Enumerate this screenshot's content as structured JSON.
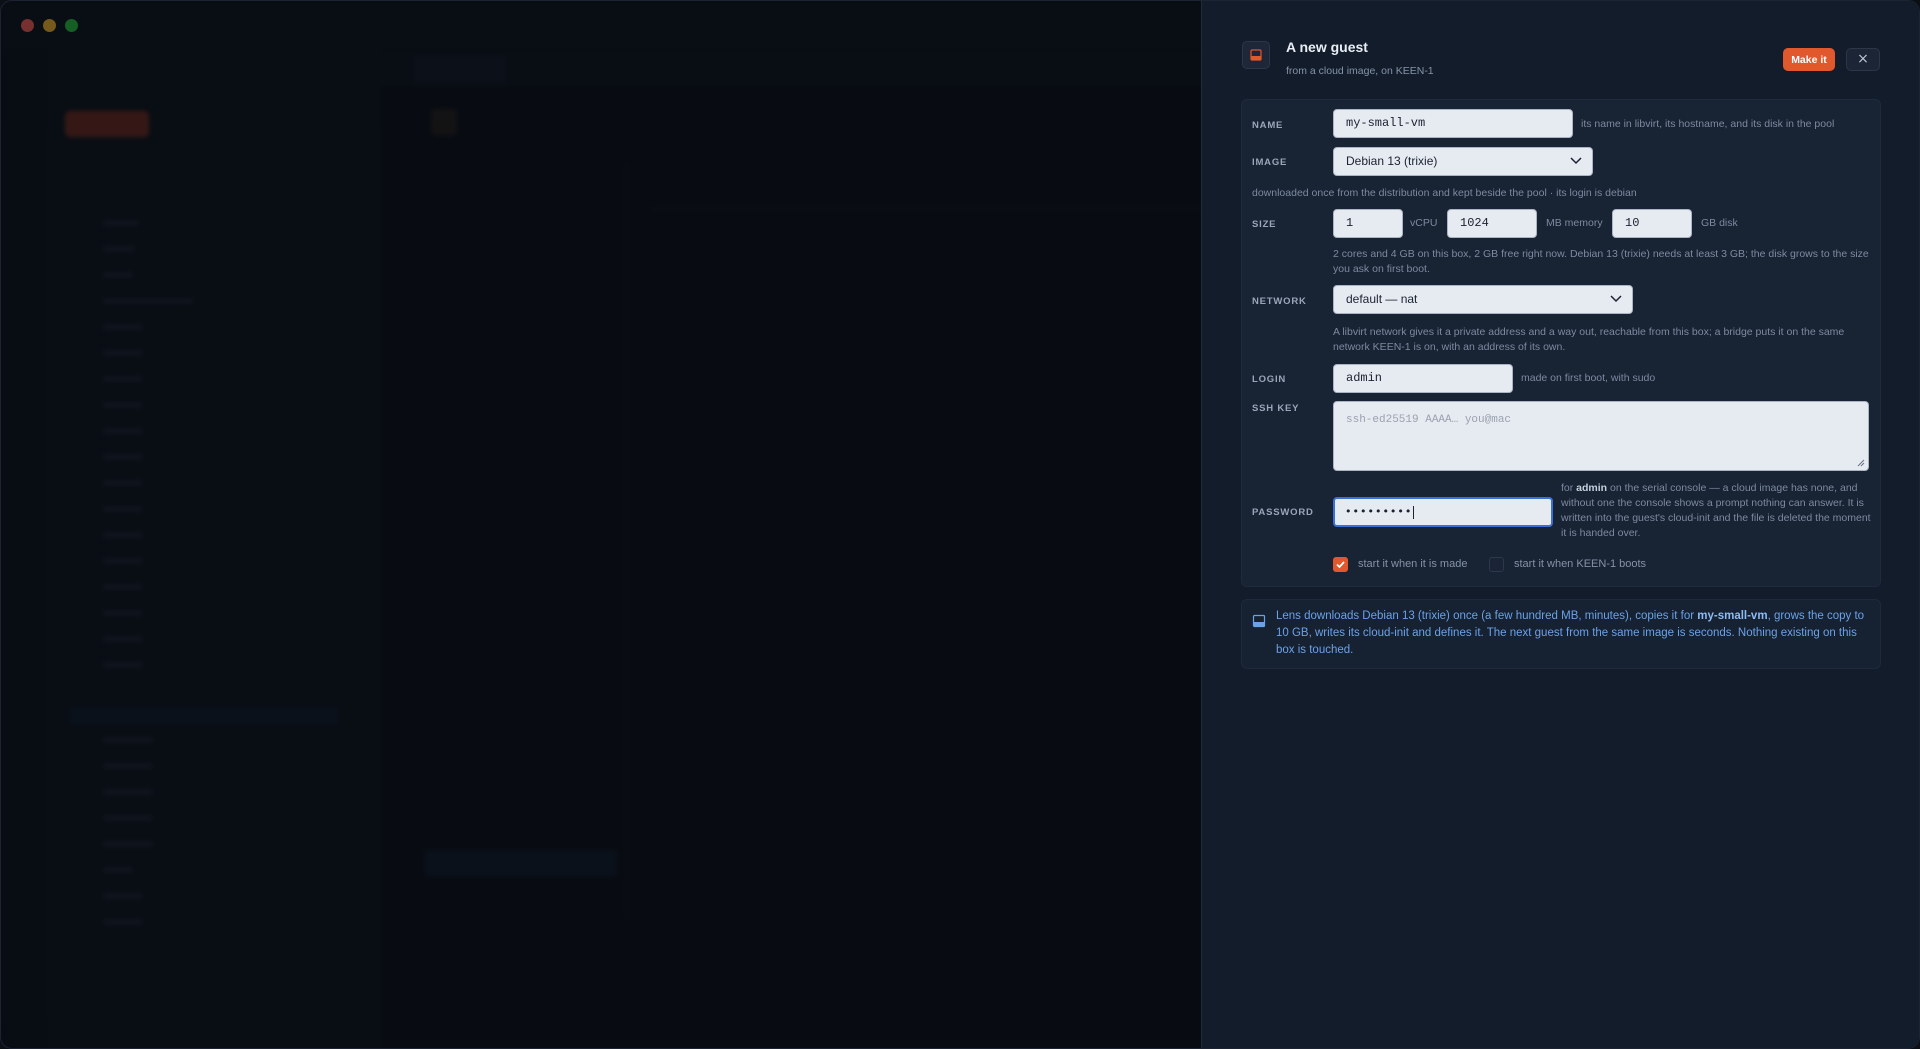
{
  "drawer": {
    "title": "A new guest",
    "subtitle": "from a cloud image, on KEEN-1",
    "make_label": "Make it",
    "close_glyph": "×",
    "icon": "vm-image-icon"
  },
  "form": {
    "name": {
      "label": "NAME",
      "value": "my-small-vm",
      "hint": "its name in libvirt, its hostname, and its disk in the pool"
    },
    "image": {
      "label": "IMAGE",
      "value": "Debian 13 (trixie)",
      "hint": "downloaded once from the distribution and kept beside the pool · its login is debian"
    },
    "size": {
      "label": "SIZE",
      "vcpu": "1",
      "vcpu_unit": "vCPU",
      "memory": "1024",
      "memory_unit": "MB memory",
      "disk": "10",
      "disk_unit": "GB disk",
      "hint": "2 cores and 4 GB on this box, 2 GB free right now. Debian 13 (trixie) needs at least 3 GB; the disk grows to the size you ask on first boot."
    },
    "network": {
      "label": "NETWORK",
      "value": "default — nat",
      "hint": "A libvirt network gives it a private address and a way out, reachable from this box; a bridge puts it on the same network KEEN-1 is on, with an address of its own."
    },
    "login": {
      "label": "LOGIN",
      "value": "admin",
      "hint": "made on first boot, with sudo"
    },
    "ssh_key": {
      "label": "SSH KEY",
      "placeholder": "ssh-ed25519 AAAA… you@mac"
    },
    "password": {
      "label": "PASSWORD",
      "masked_value": "•••••••••",
      "hint_prefix": "for ",
      "hint_user": "admin",
      "hint_rest": " on the serial console — a cloud image has none, and without one the console shows a prompt nothing can answer. It is written into the guest's cloud-init and the file is deleted the moment it is handed over."
    },
    "start_when_made": {
      "label": "start it when it is made",
      "checked": true
    },
    "start_when_boots": {
      "label": "start it when KEEN-1 boots",
      "checked": false
    }
  },
  "info": {
    "part1": "Lens downloads Debian 13 (trixie) once (a few hundred MB, minutes), copies it for ",
    "vm_name": "my-small-vm",
    "part2": ", grows the copy to 10 GB, writes its cloud-init and defines it. The next guest from the same image is seconds. Nothing existing on this box is touched."
  },
  "colors": {
    "accent": "#e0582b",
    "focus": "#3b6fd8",
    "info_text": "#6aa2ea",
    "drawer_bg": "#131c2a"
  }
}
